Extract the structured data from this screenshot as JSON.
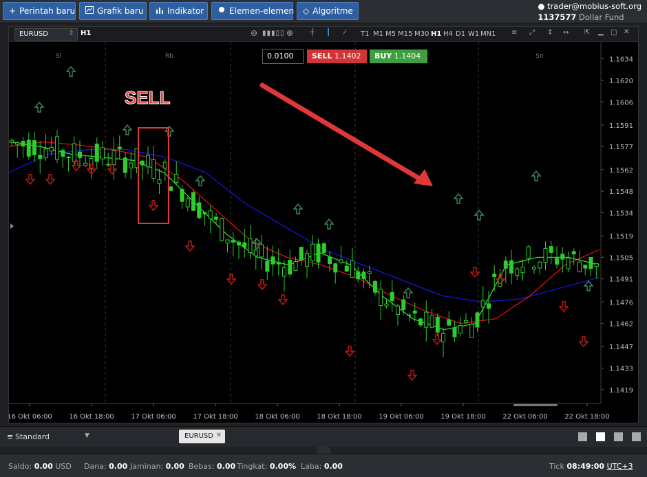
{
  "toolbar": {
    "new_order": "Perintah baru",
    "new_chart": "Grafik baru",
    "indicator": "Indikator",
    "elements": "Elemen-elemen",
    "algorithm": "Algoritme"
  },
  "account": {
    "email": "trader@mobius-soft.org",
    "id": "1137577",
    "fund": "Dollar Fund"
  },
  "chart": {
    "symbol": "EURUSD",
    "timeframe": "H1",
    "timeframes": [
      "T1",
      "M1",
      "M5",
      "M15",
      "M30",
      "H1",
      "H4",
      "D1",
      "W1",
      "MN1"
    ],
    "active_timeframe": "H1",
    "lot": "0.0100",
    "sell_label": "SELL",
    "sell_price": "1.1402",
    "buy_label": "BUY",
    "buy_price": "1.1404",
    "annotation_text": "SELL",
    "day_labels": [
      "Sl",
      "Rb",
      "Sn"
    ],
    "colors": {
      "sell": "#d03434",
      "buy": "#3f9e3f",
      "bull": "#2ecc2e",
      "bear": "#2ecc2e",
      "up_arrow": "#3f8a5a",
      "down_arrow": "#d01818",
      "ma_fast": "#28e028",
      "ma_mid": "#e01010",
      "ma_slow": "#1414e0",
      "annotation": "#e03838"
    }
  },
  "chart_data": {
    "type": "candlestick",
    "y_ticks": [
      "1.1634",
      "1.1620",
      "1.1606",
      "1.1591",
      "1.1577",
      "1.1562",
      "1.1548",
      "1.1534",
      "1.1519",
      "1.1505",
      "1.1491",
      "1.1476",
      "1.1462",
      "1.1447",
      "1.1433",
      "1.1419"
    ],
    "ylim": [
      1.141,
      1.1645
    ],
    "x_labels": [
      "16 Okt 06:00",
      "16 Okt 18:00",
      "17 Okt 06:00",
      "17 Okt 18:00",
      "18 Okt 06:00",
      "18 Okt 18:00",
      "19 Okt 06:00",
      "19 Okt 18:00",
      "22 Okt 06:00",
      "22 Okt 18:00"
    ],
    "ma_fast": [
      1.158,
      1.1577,
      1.1572,
      1.157,
      1.1568,
      1.156,
      1.154,
      1.152,
      1.1505,
      1.15,
      1.1508,
      1.15,
      1.148,
      1.1465,
      1.1458,
      1.1462,
      1.15,
      1.1505,
      1.1505,
      1.15
    ],
    "ma_mid": [
      1.1577,
      1.158,
      1.1578,
      1.1575,
      1.157,
      1.1555,
      1.1535,
      1.1515,
      1.1505,
      1.15,
      1.1492,
      1.148,
      1.147,
      1.1462,
      1.1465,
      1.148,
      1.15,
      1.151
    ],
    "ma_slow": [
      1.156,
      1.1572,
      1.1575,
      1.1575,
      1.157,
      1.156,
      1.154,
      1.1525,
      1.151,
      1.15,
      1.149,
      1.148,
      1.1476,
      1.1478,
      1.1485,
      1.1492
    ]
  },
  "bottom": {
    "layout": "Standard",
    "tab": "EURUSD"
  },
  "status": {
    "saldo_label": "Saldo:",
    "saldo": "0.00",
    "saldo_currency": "USD",
    "dana_label": "Dana:",
    "dana": "0.00",
    "jaminan_label": "Jaminan:",
    "jaminan": "0.00",
    "bebas_label": "Bebas:",
    "bebas": "0.00",
    "tingkat_label": "Tingkat:",
    "tingkat": "0.00%",
    "laba_label": "Laba:",
    "laba": "0.00",
    "tick_label": "Tick",
    "time": "08:49:00",
    "tz": "UTC+3"
  }
}
